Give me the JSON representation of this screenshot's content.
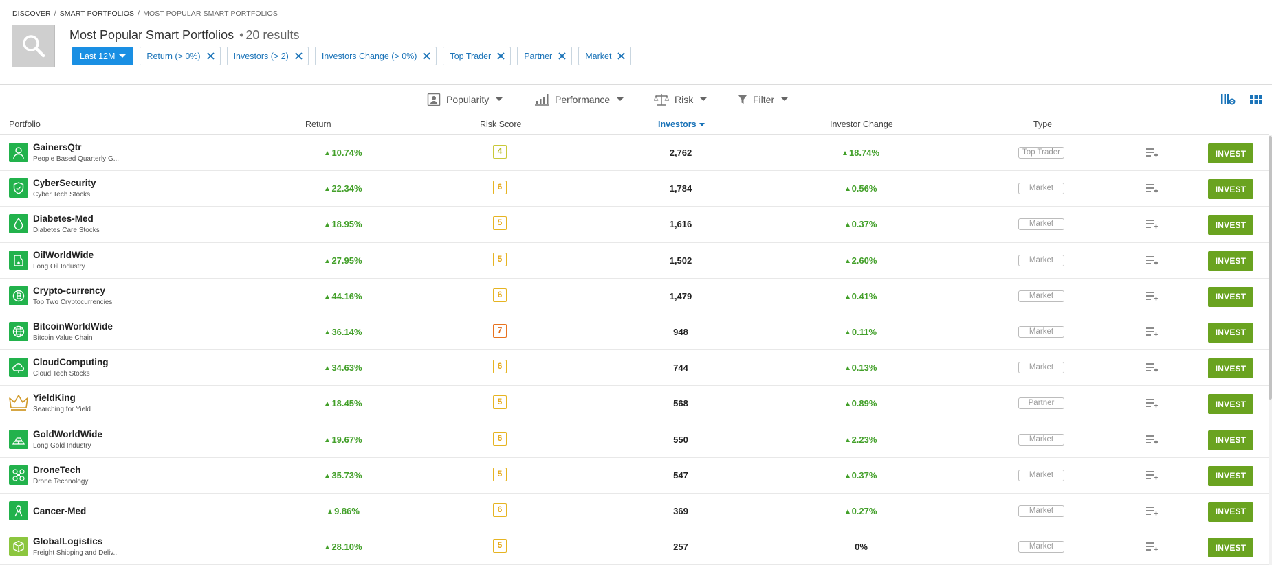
{
  "breadcrumb": {
    "items": [
      "DISCOVER",
      "SMART PORTFOLIOS"
    ],
    "current": "MOST POPULAR SMART PORTFOLIOS"
  },
  "header": {
    "title": "Most Popular Smart Portfolios",
    "results": "20 results"
  },
  "filters": {
    "period": "Last 12M",
    "chips": [
      "Return (> 0%)",
      "Investors (> 2)",
      "Investors Change (> 0%)",
      "Top Trader",
      "Partner",
      "Market"
    ]
  },
  "toolbar": {
    "popularity": "Popularity",
    "performance": "Performance",
    "risk": "Risk",
    "filter": "Filter"
  },
  "columns": {
    "portfolio": "Portfolio",
    "return": "Return",
    "risk": "Risk Score",
    "investors": "Investors",
    "change": "Investor Change",
    "type": "Type"
  },
  "invest_label": "INVEST",
  "colors": {
    "accent_blue": "#1a8fe3",
    "positive_green": "#43a02a",
    "invest_green": "#6aa320",
    "avatar_green": "#22b24c"
  },
  "rows": [
    {
      "name": "GainersQtr",
      "desc": "People Based Quarterly G...",
      "ret": "10.74%",
      "risk": "4",
      "investors": "2,762",
      "change": "18.74%",
      "type": "Top Trader",
      "icon": "person-icon"
    },
    {
      "name": "CyberSecurity",
      "desc": "Cyber Tech Stocks",
      "ret": "22.34%",
      "risk": "6",
      "investors": "1,784",
      "change": "0.56%",
      "type": "Market",
      "icon": "shield-icon"
    },
    {
      "name": "Diabetes-Med",
      "desc": "Diabetes Care Stocks",
      "ret": "18.95%",
      "risk": "5",
      "investors": "1,616",
      "change": "0.37%",
      "type": "Market",
      "icon": "drop-icon"
    },
    {
      "name": "OilWorldWide",
      "desc": "Long Oil Industry",
      "ret": "27.95%",
      "risk": "5",
      "investors": "1,502",
      "change": "2.60%",
      "type": "Market",
      "icon": "oil-can-icon"
    },
    {
      "name": "Crypto-currency",
      "desc": "Top Two Cryptocurrencies",
      "ret": "44.16%",
      "risk": "6",
      "investors": "1,479",
      "change": "0.41%",
      "type": "Market",
      "icon": "coin-icon"
    },
    {
      "name": "BitcoinWorldWide",
      "desc": "Bitcoin Value Chain",
      "ret": "36.14%",
      "risk": "7",
      "investors": "948",
      "change": "0.11%",
      "type": "Market",
      "icon": "globe-icon"
    },
    {
      "name": "CloudComputing",
      "desc": "Cloud Tech Stocks",
      "ret": "34.63%",
      "risk": "6",
      "investors": "744",
      "change": "0.13%",
      "type": "Market",
      "icon": "cloud-icon"
    },
    {
      "name": "YieldKing",
      "desc": "Searching for Yield",
      "ret": "18.45%",
      "risk": "5",
      "investors": "568",
      "change": "0.89%",
      "type": "Partner",
      "icon": "crown-icon"
    },
    {
      "name": "GoldWorldWide",
      "desc": "Long Gold Industry",
      "ret": "19.67%",
      "risk": "6",
      "investors": "550",
      "change": "2.23%",
      "type": "Market",
      "icon": "gold-bars-icon"
    },
    {
      "name": "DroneTech",
      "desc": "Drone Technology",
      "ret": "35.73%",
      "risk": "5",
      "investors": "547",
      "change": "0.37%",
      "type": "Market",
      "icon": "drone-icon"
    },
    {
      "name": "Cancer-Med",
      "desc": "",
      "ret": "9.86%",
      "risk": "6",
      "investors": "369",
      "change": "0.27%",
      "type": "Market",
      "icon": "ribbon-icon"
    },
    {
      "name": "GlobalLogistics",
      "desc": "Freight Shipping and Deliv...",
      "ret": "28.10%",
      "risk": "5",
      "investors": "257",
      "change": "0%",
      "type": "Market",
      "icon": "package-icon"
    }
  ]
}
